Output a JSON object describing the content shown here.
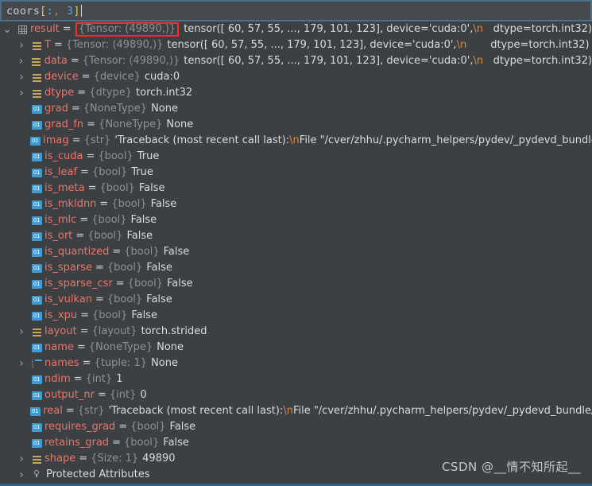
{
  "expression_bar": {
    "name": "expression-input",
    "value": "coors[:, 3]",
    "tokens": [
      {
        "text": "coors",
        "kind": "ident"
      },
      {
        "text": "[",
        "kind": "bracket"
      },
      {
        "text": ":",
        "kind": "colon"
      },
      {
        "text": ",",
        "kind": "comma"
      },
      {
        "text": " 3",
        "kind": "num"
      },
      {
        "text": "]",
        "kind": "bracket"
      }
    ]
  },
  "colors": {
    "background": "#3c4043",
    "input_background": "#45494c",
    "input_border": "#4a708b",
    "name_text": "#e8756b",
    "type_text": "#8d9296",
    "value_text": "#d9dcde",
    "escape_text": "#d98c3f",
    "highlight_border": "#ff2a2a",
    "icon_lines": "#c8a456",
    "icon_badge": "#3f9ad1",
    "bottom_accent": "#2b6089"
  },
  "tree": {
    "rows": [
      {
        "indent": 0,
        "arrow": "expanded",
        "icon": "grid-icon",
        "name": "result",
        "eq": "=",
        "type": "{Tensor: (49890,)}",
        "highlight": true,
        "value": "tensor([ 60,  57,  55,  ..., 179, 101, 123], device='cuda:0',",
        "escape": "\\n",
        "gap": true,
        "trail": "dtype=torch.int32)"
      },
      {
        "indent": 1,
        "arrow": "collapsed",
        "icon": "lines-icon",
        "name": "T",
        "eq": "=",
        "type": "{Tensor: (49890,)}",
        "highlight": false,
        "value": "tensor([ 60,  57,  55,  ..., 179, 101, 123], device='cuda:0',",
        "escape": "\\n",
        "gap": true,
        "trail": "dtype=torch.int32)"
      },
      {
        "indent": 1,
        "arrow": "collapsed",
        "icon": "lines-icon",
        "name": "data",
        "eq": "=",
        "type": "{Tensor: (49890,)}",
        "highlight": false,
        "value": "tensor([ 60,  57,  55,  ..., 179, 101, 123], device='cuda:0',",
        "escape": "\\n",
        "gap": true,
        "trail": "dtype=torch.int32)"
      },
      {
        "indent": 1,
        "arrow": "collapsed",
        "icon": "lines-icon",
        "name": "device",
        "eq": "=",
        "type": "{device}",
        "highlight": false,
        "value": "cuda:0",
        "escape": "",
        "gap": false,
        "trail": ""
      },
      {
        "indent": 1,
        "arrow": "collapsed",
        "icon": "lines-icon",
        "name": "dtype",
        "eq": "=",
        "type": "{dtype}",
        "highlight": false,
        "value": "torch.int32",
        "escape": "",
        "gap": false,
        "trail": ""
      },
      {
        "indent": 1,
        "arrow": "none",
        "icon": "primitive-icon",
        "name": "grad",
        "eq": "=",
        "type": "{NoneType}",
        "highlight": false,
        "value": "None",
        "escape": "",
        "gap": false,
        "trail": ""
      },
      {
        "indent": 1,
        "arrow": "none",
        "icon": "primitive-icon",
        "name": "grad_fn",
        "eq": "=",
        "type": "{NoneType}",
        "highlight": false,
        "value": "None",
        "escape": "",
        "gap": false,
        "trail": ""
      },
      {
        "indent": 1,
        "arrow": "none",
        "icon": "primitive-icon",
        "name": "imag",
        "eq": "=",
        "type": "{str}",
        "highlight": false,
        "value": "'Traceback (most recent call last):",
        "escape": "\\n",
        "gap": false,
        "trail": " File \"/cver/zhhu/.pycharm_helpers/pydev/_pydevd_bundle/pydevd_re"
      },
      {
        "indent": 1,
        "arrow": "none",
        "icon": "primitive-icon",
        "name": "is_cuda",
        "eq": "=",
        "type": "{bool}",
        "highlight": false,
        "value": "True",
        "escape": "",
        "gap": false,
        "trail": ""
      },
      {
        "indent": 1,
        "arrow": "none",
        "icon": "primitive-icon",
        "name": "is_leaf",
        "eq": "=",
        "type": "{bool}",
        "highlight": false,
        "value": "True",
        "escape": "",
        "gap": false,
        "trail": ""
      },
      {
        "indent": 1,
        "arrow": "none",
        "icon": "primitive-icon",
        "name": "is_meta",
        "eq": "=",
        "type": "{bool}",
        "highlight": false,
        "value": "False",
        "escape": "",
        "gap": false,
        "trail": ""
      },
      {
        "indent": 1,
        "arrow": "none",
        "icon": "primitive-icon",
        "name": "is_mkldnn",
        "eq": "=",
        "type": "{bool}",
        "highlight": false,
        "value": "False",
        "escape": "",
        "gap": false,
        "trail": ""
      },
      {
        "indent": 1,
        "arrow": "none",
        "icon": "primitive-icon",
        "name": "is_mlc",
        "eq": "=",
        "type": "{bool}",
        "highlight": false,
        "value": "False",
        "escape": "",
        "gap": false,
        "trail": ""
      },
      {
        "indent": 1,
        "arrow": "none",
        "icon": "primitive-icon",
        "name": "is_ort",
        "eq": "=",
        "type": "{bool}",
        "highlight": false,
        "value": "False",
        "escape": "",
        "gap": false,
        "trail": ""
      },
      {
        "indent": 1,
        "arrow": "none",
        "icon": "primitive-icon",
        "name": "is_quantized",
        "eq": "=",
        "type": "{bool}",
        "highlight": false,
        "value": "False",
        "escape": "",
        "gap": false,
        "trail": ""
      },
      {
        "indent": 1,
        "arrow": "none",
        "icon": "primitive-icon",
        "name": "is_sparse",
        "eq": "=",
        "type": "{bool}",
        "highlight": false,
        "value": "False",
        "escape": "",
        "gap": false,
        "trail": ""
      },
      {
        "indent": 1,
        "arrow": "none",
        "icon": "primitive-icon",
        "name": "is_sparse_csr",
        "eq": "=",
        "type": "{bool}",
        "highlight": false,
        "value": "False",
        "escape": "",
        "gap": false,
        "trail": ""
      },
      {
        "indent": 1,
        "arrow": "none",
        "icon": "primitive-icon",
        "name": "is_vulkan",
        "eq": "=",
        "type": "{bool}",
        "highlight": false,
        "value": "False",
        "escape": "",
        "gap": false,
        "trail": ""
      },
      {
        "indent": 1,
        "arrow": "none",
        "icon": "primitive-icon",
        "name": "is_xpu",
        "eq": "=",
        "type": "{bool}",
        "highlight": false,
        "value": "False",
        "escape": "",
        "gap": false,
        "trail": ""
      },
      {
        "indent": 1,
        "arrow": "collapsed",
        "icon": "lines-icon",
        "name": "layout",
        "eq": "=",
        "type": "{layout}",
        "highlight": false,
        "value": "torch.strided",
        "escape": "",
        "gap": false,
        "trail": ""
      },
      {
        "indent": 1,
        "arrow": "none",
        "icon": "primitive-icon",
        "name": "name",
        "eq": "=",
        "type": "{NoneType}",
        "highlight": false,
        "value": "None",
        "escape": "",
        "gap": false,
        "trail": ""
      },
      {
        "indent": 1,
        "arrow": "collapsed",
        "icon": "numbered-list-icon",
        "name": "names",
        "eq": "=",
        "type": "{tuple: 1}",
        "highlight": false,
        "value": "None",
        "escape": "",
        "gap": false,
        "trail": ""
      },
      {
        "indent": 1,
        "arrow": "none",
        "icon": "primitive-icon",
        "name": "ndim",
        "eq": "=",
        "type": "{int}",
        "highlight": false,
        "value": "1",
        "escape": "",
        "gap": false,
        "trail": ""
      },
      {
        "indent": 1,
        "arrow": "none",
        "icon": "primitive-icon",
        "name": "output_nr",
        "eq": "=",
        "type": "{int}",
        "highlight": false,
        "value": "0",
        "escape": "",
        "gap": false,
        "trail": ""
      },
      {
        "indent": 1,
        "arrow": "none",
        "icon": "primitive-icon",
        "name": "real",
        "eq": "=",
        "type": "{str}",
        "highlight": false,
        "value": "'Traceback (most recent call last):",
        "escape": "\\n",
        "gap": false,
        "trail": " File \"/cver/zhhu/.pycharm_helpers/pydev/_pydevd_bundle/pydevd_res"
      },
      {
        "indent": 1,
        "arrow": "none",
        "icon": "primitive-icon",
        "name": "requires_grad",
        "eq": "=",
        "type": "{bool}",
        "highlight": false,
        "value": "False",
        "escape": "",
        "gap": false,
        "trail": ""
      },
      {
        "indent": 1,
        "arrow": "none",
        "icon": "primitive-icon",
        "name": "retains_grad",
        "eq": "=",
        "type": "{bool}",
        "highlight": false,
        "value": "False",
        "escape": "",
        "gap": false,
        "trail": ""
      },
      {
        "indent": 1,
        "arrow": "collapsed",
        "icon": "lines-icon",
        "name": "shape",
        "eq": "=",
        "type": "{Size: 1}",
        "highlight": false,
        "value": "49890",
        "escape": "",
        "gap": false,
        "trail": ""
      },
      {
        "indent": 1,
        "arrow": "collapsed",
        "icon": "key-icon",
        "name": "",
        "eq": "",
        "type": "",
        "highlight": false,
        "plain": "Protected Attributes",
        "escape": "",
        "gap": false,
        "trail": ""
      }
    ]
  },
  "watermark": {
    "text": "CSDN @__情不知所起__"
  }
}
